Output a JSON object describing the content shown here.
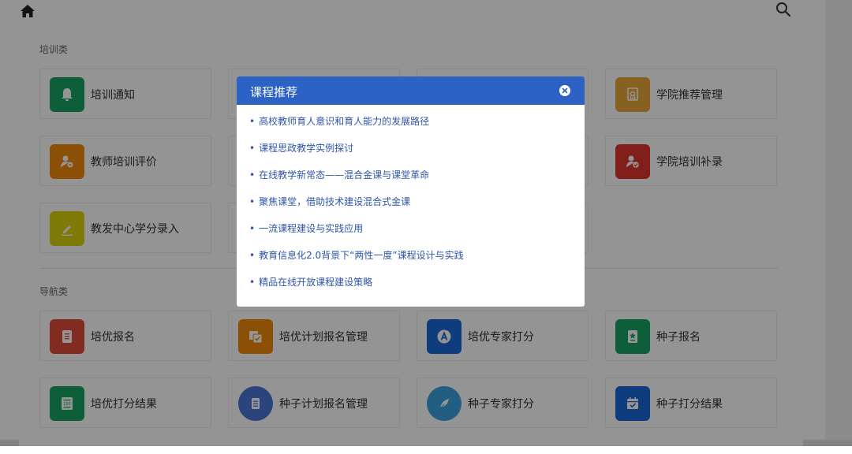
{
  "sections": [
    {
      "title": "培训类"
    },
    {
      "title": "导航类"
    }
  ],
  "training_cards": [
    {
      "label": "培训通知",
      "icon": "bell-icon",
      "color": "#1aa364"
    },
    {
      "label": "",
      "icon": "",
      "color": ""
    },
    {
      "label": "",
      "icon": "",
      "color": ""
    },
    {
      "label": "学院推荐管理",
      "icon": "certificate-icon",
      "color": "#e8a73a"
    },
    {
      "label": "教师培训评价",
      "icon": "user-badge-icon",
      "color": "#f08a0c"
    },
    {
      "label": "学院培训补录",
      "icon": "user-check-icon",
      "color": "#e0352b"
    },
    {
      "label": "教发中心学分录入",
      "icon": "pencil-icon",
      "color": "#d9d20a"
    }
  ],
  "nav_cards": [
    {
      "label": "培优报名",
      "icon": "document-icon",
      "color": "#e04a3a"
    },
    {
      "label": "培优计划报名管理",
      "icon": "checklist-icon",
      "color": "#f08a0c"
    },
    {
      "label": "培优专家打分",
      "icon": "letter-a-icon",
      "color": "#1a68d6"
    },
    {
      "label": "种子报名",
      "icon": "star-doc-icon",
      "color": "#1aa364"
    },
    {
      "label": "培优打分结果",
      "icon": "score-doc-icon",
      "color": "#1aa364"
    },
    {
      "label": "种子计划报名管理",
      "icon": "list-doc-icon",
      "color": "#4a76d8"
    },
    {
      "label": "种子专家打分",
      "icon": "feather-icon",
      "color": "#3aa3e0"
    },
    {
      "label": "种子打分结果",
      "icon": "calendar-check-icon",
      "color": "#1a68d6"
    }
  ],
  "modal": {
    "title": "课程推荐",
    "items": [
      "高校教师育人意识和育人能力的发展路径",
      "课程思政教学实例探讨",
      "在线教学新常态——混合金课与课堂革命",
      "聚焦课堂，借助技术建设混合式金课",
      "一流课程建设与实践应用",
      "教育信息化2.0背景下“两性一度”课程设计与实践",
      "精品在线开放课程建设策略"
    ]
  },
  "colors": {
    "modal_header": "#2d62c5",
    "link": "#2f55a8"
  }
}
